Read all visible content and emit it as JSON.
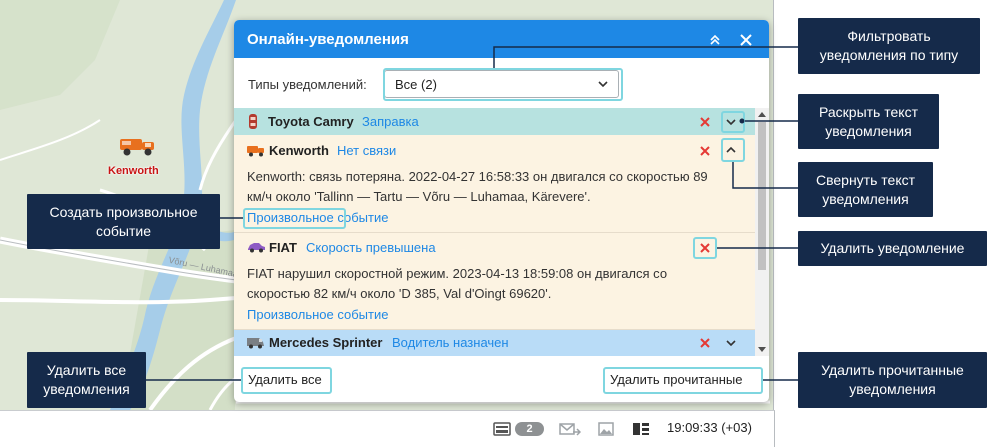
{
  "panel": {
    "title": "Онлайн-уведомления",
    "filter_label": "Типы уведомлений:",
    "filter_value": "Все (2)",
    "delete_all_label": "Удалить все",
    "delete_read_label": "Удалить прочитанные"
  },
  "notifications": [
    {
      "unit": "Toyota Camry",
      "type": "Заправка",
      "expanded": false
    },
    {
      "unit": "Kenworth",
      "type": "Нет связи",
      "expanded": true,
      "message": "Kenworth: связь потеряна. 2022-04-27 16:58:33 он двигался со скоростью 89 км/ч около 'Tallinn — Tartu — Võru — Luhamaa, Kärevere'.",
      "link": "Произвольное событие"
    },
    {
      "unit": "FIAT",
      "type": "Скорость превышена",
      "expanded": true,
      "message": "FIAT нарушил скоростной режим. 2023-04-13 18:59:08 он двигался со скоростью 82 км/ч около 'D 385, Val d'Oingt 69620'.",
      "link": "Произвольное событие"
    },
    {
      "unit": "Mercedes Sprinter",
      "type": "Водитель назначен",
      "expanded": false
    }
  ],
  "map": {
    "marker_label": "Kenworth",
    "road_label": "Võru — Luhamaa"
  },
  "statusbar": {
    "badge_count": "2",
    "time": "19:09:33 (+03)"
  },
  "callouts": {
    "filter_by_type": "Фильтровать\nуведомления по типу",
    "expand_text": "Раскрыть текст\nуведомления",
    "collapse_text": "Свернуть текст\nуведомления",
    "delete_notification": "Удалить уведомление",
    "delete_read": "Удалить прочитанные\nуведомления",
    "create_custom_event": "Создать произвольное\nсобытие",
    "delete_all": "Удалить все\nуведомления"
  },
  "colors": {
    "header_blue": "#1e88e5",
    "callout_navy": "#152a4a",
    "highlight_cyan": "#7fd6e0",
    "delete_red": "#e53935",
    "row_teal": "#b7e2e0",
    "row_cream": "#fcf3e2",
    "row_blue": "#b9dcf7"
  }
}
